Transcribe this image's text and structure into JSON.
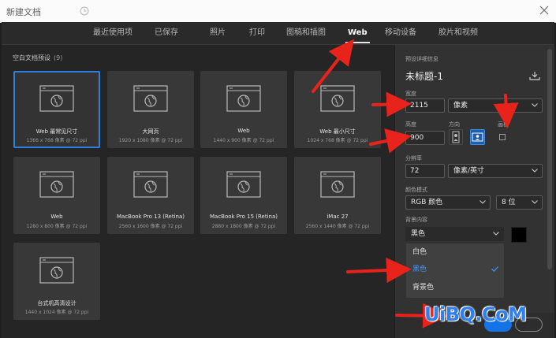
{
  "window": {
    "title": "新建文档"
  },
  "tabs": [
    {
      "label": "最近使用项"
    },
    {
      "label": "已保存"
    },
    {
      "label": "照片"
    },
    {
      "label": "打印"
    },
    {
      "label": "图稿和插图"
    },
    {
      "label": "Web",
      "active": true
    },
    {
      "label": "移动设备"
    },
    {
      "label": "胶片和视频"
    }
  ],
  "presets": {
    "heading": "空白文档预设",
    "count": "(9)",
    "items": [
      {
        "name": "Web 最常见尺寸",
        "dims": "1366 x 768 像素 @ 72 ppi",
        "selected": true
      },
      {
        "name": "大网页",
        "dims": "1920 x 1080 像素 @ 72 ppi"
      },
      {
        "name": "Web",
        "dims": "1440 x 900 像素 @ 72 ppi"
      },
      {
        "name": "Web 最小尺寸",
        "dims": "1024 x 768 像素 @ 72 ppi"
      },
      {
        "name": "Web",
        "dims": "1280 x 800 像素 @ 72 ppi"
      },
      {
        "name": "MacBook Pro 13 (Retina)",
        "dims": "2560 x 1600 像素 @ 72 ppi"
      },
      {
        "name": "MacBook Pro 15 (Retina)",
        "dims": "2880 x 1800 像素 @ 72 ppi"
      },
      {
        "name": "iMac 27",
        "dims": "2560 x 1440 像素 @ 72 ppi"
      },
      {
        "name": "台式机高清设计",
        "dims": "1440 x 1024 像素 @ 72 ppi"
      }
    ]
  },
  "details": {
    "heading": "预设详细信息",
    "doc_title": "未标题-1",
    "width_label": "宽度",
    "width_value": "2115",
    "width_unit": "像素",
    "height_label": "高度",
    "height_value": "900",
    "orientation_label": "方向",
    "artboard_label": "画板",
    "resolution_label": "分辨率",
    "resolution_value": "72",
    "resolution_unit": "像素/英寸",
    "color_mode_label": "颜色模式",
    "color_mode_value": "RGB 颜色",
    "bit_depth_value": "8 位",
    "bg_label": "背景内容",
    "bg_value": "黑色",
    "bg_options": [
      "白色",
      "黑色",
      "背景色"
    ],
    "bg_selected": "黑色"
  },
  "watermark": "UiBQ.CoM",
  "colors": {
    "accent": "#1473e6",
    "selection_border": "#2e7fe0",
    "arrow": "#e8231c"
  }
}
